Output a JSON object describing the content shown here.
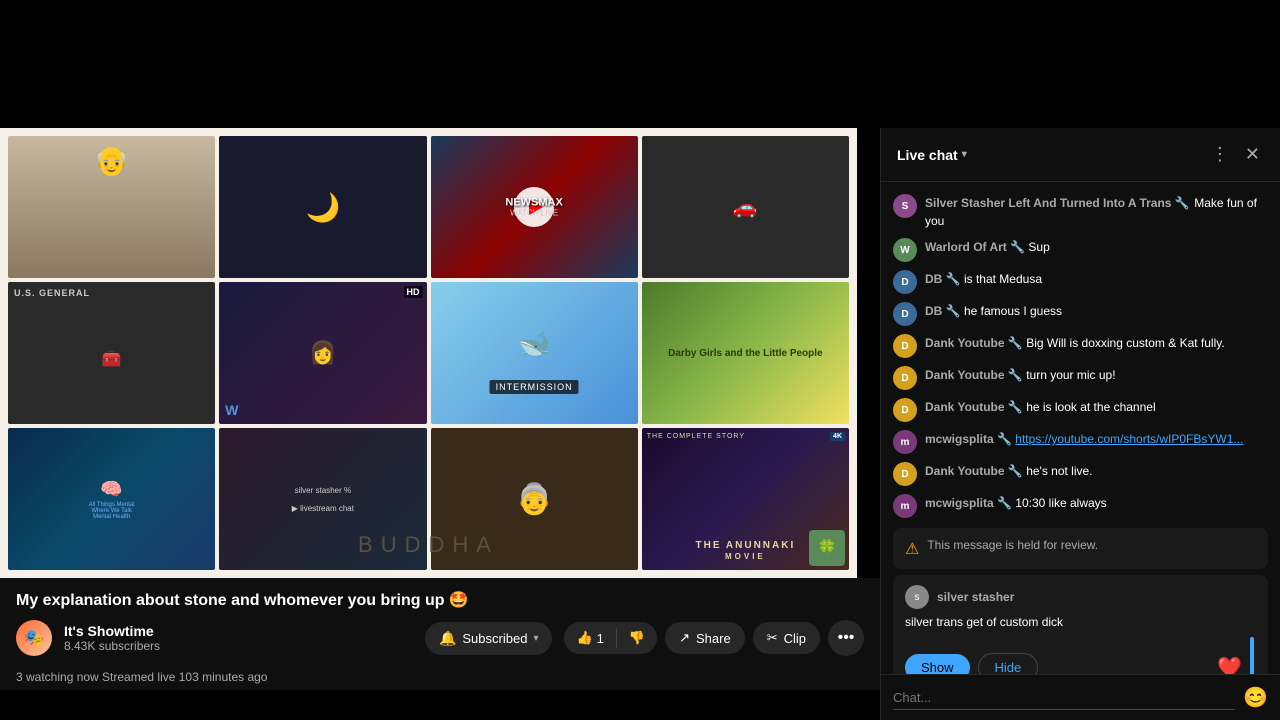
{
  "topbar": {
    "bg": "#000"
  },
  "video": {
    "title": "My explanation about stone and whomever you bring up 🤩",
    "thumbnails": [
      {
        "id": 1,
        "type": "person"
      },
      {
        "id": 2,
        "type": "moon"
      },
      {
        "id": 3,
        "type": "newsmax"
      },
      {
        "id": 4,
        "type": "car"
      },
      {
        "id": 5,
        "type": "us-general"
      },
      {
        "id": 6,
        "type": "person-hd"
      },
      {
        "id": 7,
        "type": "intermission"
      },
      {
        "id": 8,
        "type": "darby"
      },
      {
        "id": 9,
        "type": "mental"
      },
      {
        "id": 10,
        "type": "livestream"
      },
      {
        "id": 11,
        "type": "old-person"
      },
      {
        "id": 12,
        "type": "anunnaki"
      }
    ],
    "buddha_label": "BUDDHA",
    "meta": "3 watching now  Streamed live 103 minutes ago",
    "actions": {
      "like_count": "1",
      "like_label": "👍",
      "dislike_label": "👎",
      "share_label": "Share",
      "clip_label": "Clip",
      "more_label": "•••"
    }
  },
  "channel": {
    "name": "It's Showtime",
    "subscribers": "8.43K subscribers",
    "subscribe_label": "Subscribed",
    "bell_label": "🔔",
    "dropdown_label": "▾"
  },
  "chat": {
    "title": "Live chat",
    "title_arrow": "▾",
    "messages": [
      {
        "id": 1,
        "avatar_color": "#8a4a8a",
        "avatar_initial": "S",
        "username": "Silver Stasher Left And Turned Into A Trans 🔧",
        "username_color": "#aaa",
        "text": "Make fun of you"
      },
      {
        "id": 2,
        "avatar_color": "#5a8a5a",
        "avatar_initial": "W",
        "username": "Warlord Of Art 🔧",
        "username_color": "#aaa",
        "text": "Sup"
      },
      {
        "id": 3,
        "avatar_color": "#3a6a9a",
        "avatar_initial": "D",
        "username": "DB 🔧",
        "username_color": "#aaa",
        "text": "is that Medusa"
      },
      {
        "id": 4,
        "avatar_color": "#3a6a9a",
        "avatar_initial": "D",
        "username": "DB 🔧",
        "username_color": "#aaa",
        "text": "he famous I guess"
      },
      {
        "id": 5,
        "avatar_color": "#d4a020",
        "avatar_initial": "D",
        "username": "Dank Youtube 🔧",
        "username_color": "#aaa",
        "text": "Big Will is doxxing custom & Kat fully."
      },
      {
        "id": 6,
        "avatar_color": "#d4a020",
        "avatar_initial": "D",
        "username": "Dank Youtube 🔧",
        "username_color": "#aaa",
        "text": "turn your mic up!"
      },
      {
        "id": 7,
        "avatar_color": "#d4a020",
        "avatar_initial": "D",
        "username": "Dank Youtube 🔧",
        "username_color": "#aaa",
        "text": "he is look at the channel"
      },
      {
        "id": 8,
        "avatar_color": "#7a3a7a",
        "avatar_initial": "m",
        "username": "mcwigsplita 🔧",
        "username_color": "#aaa",
        "text_link": "https://youtube.com/shorts/wIP0FBsYW1..."
      },
      {
        "id": 9,
        "avatar_color": "#d4a020",
        "avatar_initial": "D",
        "username": "Dank Youtube 🔧",
        "username_color": "#aaa",
        "text": "he's not live."
      },
      {
        "id": 10,
        "avatar_color": "#7a3a7a",
        "avatar_initial": "m",
        "username": "mcwigsplita 🔧",
        "username_color": "#aaa",
        "text": "10:30 like always"
      }
    ],
    "held_message_text": "This message is held for review.",
    "silver_username": "silver stasher",
    "silver_text": "silver trans get of custom dick",
    "show_label": "Show",
    "hide_label": "Hide",
    "chat_placeholder": "Chat...",
    "scroll_color": "#3ea6ff"
  }
}
